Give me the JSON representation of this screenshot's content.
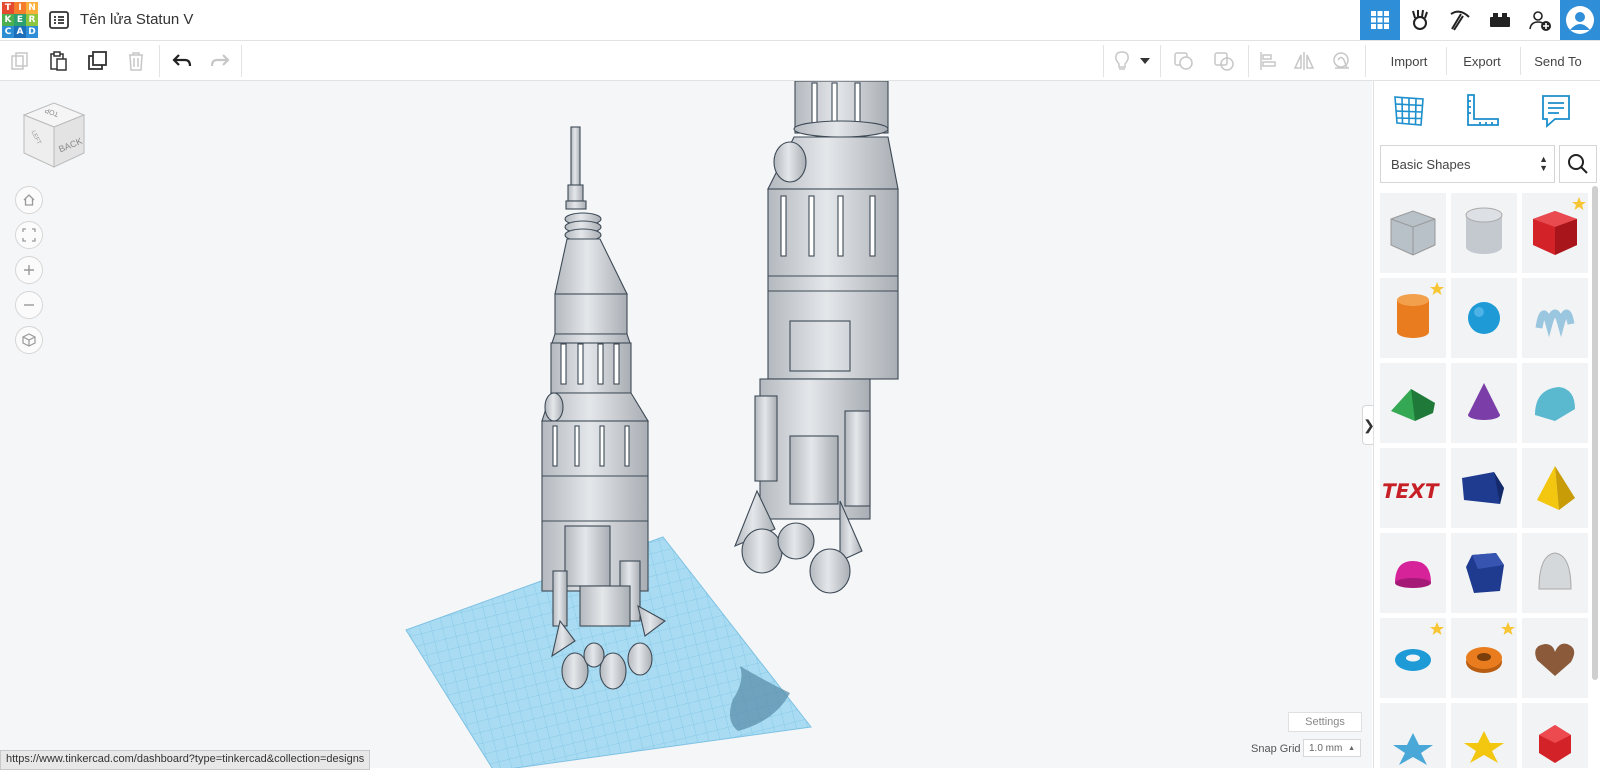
{
  "header": {
    "logo_letters": [
      "T",
      "I",
      "N",
      "K",
      "E",
      "R",
      "C",
      "A",
      "D"
    ],
    "logo_colors": [
      "#e34a30",
      "#f47c2a",
      "#fbb03b",
      "#4caf50",
      "#2ca06f",
      "#8cc63f",
      "#2d8ed4",
      "#1c6fb8",
      "#2e8fd8"
    ],
    "design_title": "Tên lửa Statun V",
    "icons": [
      "grid-view-icon",
      "sim-lab-icon",
      "pickaxe-icon",
      "bricks-icon",
      "add-user-icon",
      "user-avatar-icon"
    ]
  },
  "toolbar": {
    "left_tools": [
      "copy-icon",
      "paste-icon",
      "duplicate-icon",
      "delete-icon",
      "undo-icon",
      "redo-icon"
    ],
    "right_tools": [
      "light-icon",
      "dropdown-icon",
      "group-icon",
      "ungroup-icon",
      "align-icon",
      "mirror-icon",
      "workplane-icon"
    ],
    "import_label": "Import",
    "export_label": "Export",
    "send_to_label": "Send To"
  },
  "viewcube": {
    "top_label": "TOP",
    "back_label": "BACK",
    "left_label": "LEFT"
  },
  "nav_controls": [
    "home-view-icon",
    "fit-view-icon",
    "zoom-in-icon",
    "zoom-out-icon",
    "ortho-view-icon"
  ],
  "sidebar": {
    "tools": [
      "workplane-tool-icon",
      "ruler-tool-icon",
      "notes-tool-icon"
    ],
    "category": "Basic Shapes",
    "collapse_glyph": "❯",
    "shapes": [
      {
        "name": "box-hole",
        "color": "#b8c0c8",
        "fav": false
      },
      {
        "name": "cylinder-hole",
        "color": "#c4c9cf",
        "fav": false
      },
      {
        "name": "box",
        "color": "#d32228",
        "fav": true
      },
      {
        "name": "cylinder",
        "color": "#e87c1e",
        "fav": true
      },
      {
        "name": "sphere",
        "color": "#1e9ad6",
        "fav": false
      },
      {
        "name": "scribble",
        "color": "#9bc6df",
        "fav": false
      },
      {
        "name": "roof",
        "color": "#34a853",
        "fav": false
      },
      {
        "name": "cone",
        "color": "#7b3ea8",
        "fav": false
      },
      {
        "name": "round-roof",
        "color": "#5ab8cf",
        "fav": false
      },
      {
        "name": "text",
        "color": "#c61f26",
        "fav": false
      },
      {
        "name": "half-box",
        "color": "#1f3b8f",
        "fav": false
      },
      {
        "name": "pyramid",
        "color": "#f3c60f",
        "fav": false
      },
      {
        "name": "half-sphere",
        "color": "#d6239a",
        "fav": false
      },
      {
        "name": "polygon",
        "color": "#1f3b8f",
        "fav": false
      },
      {
        "name": "paraboloid",
        "color": "#d5d8db",
        "fav": false
      },
      {
        "name": "torus",
        "color": "#1e9ad6",
        "fav": true
      },
      {
        "name": "tube",
        "color": "#e87c1e",
        "fav": true
      },
      {
        "name": "heart",
        "color": "#8a5a3a",
        "fav": false
      },
      {
        "name": "star",
        "color": "#4aa8d9",
        "fav": false
      },
      {
        "name": "star-gold",
        "color": "#f3c60f",
        "fav": false
      },
      {
        "name": "icosahedron",
        "color": "#d32228",
        "fav": false
      }
    ]
  },
  "footer": {
    "status_url": "https://www.tinkercad.com/dashboard?type=tinkercad&collection=designs",
    "settings_label": "Settings",
    "snap_grid_label": "Snap Grid",
    "snap_grid_value": "1.0 mm"
  }
}
